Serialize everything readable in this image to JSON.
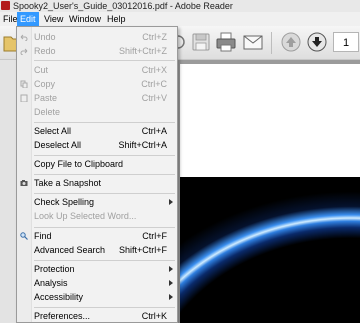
{
  "window": {
    "title": "Spooky2_User's_Guide_03012016.pdf - Adobe Reader"
  },
  "menubar": {
    "file": "File",
    "edit": "Edit",
    "view": "View",
    "window": "Window",
    "help": "Help"
  },
  "toolbar": {
    "page_number": "1"
  },
  "edit_menu": {
    "undo": {
      "label": "Undo",
      "shortcut": "Ctrl+Z"
    },
    "redo": {
      "label": "Redo",
      "shortcut": "Shift+Ctrl+Z"
    },
    "cut": {
      "label": "Cut",
      "shortcut": "Ctrl+X"
    },
    "copy": {
      "label": "Copy",
      "shortcut": "Ctrl+C"
    },
    "paste": {
      "label": "Paste",
      "shortcut": "Ctrl+V"
    },
    "delete": {
      "label": "Delete"
    },
    "select_all": {
      "label": "Select All",
      "shortcut": "Ctrl+A"
    },
    "deselect_all": {
      "label": "Deselect All",
      "shortcut": "Shift+Ctrl+A"
    },
    "copy_clipboard": {
      "label": "Copy File to Clipboard"
    },
    "snapshot": {
      "label": "Take a Snapshot"
    },
    "check_spelling": {
      "label": "Check Spelling"
    },
    "look_up": {
      "label": "Look Up Selected Word..."
    },
    "find": {
      "label": "Find",
      "shortcut": "Ctrl+F"
    },
    "advanced_search": {
      "label": "Advanced Search",
      "shortcut": "Shift+Ctrl+F"
    },
    "protection": {
      "label": "Protection"
    },
    "analysis": {
      "label": "Analysis"
    },
    "accessibility": {
      "label": "Accessibility"
    },
    "preferences": {
      "label": "Preferences...",
      "shortcut": "Ctrl+K"
    }
  }
}
